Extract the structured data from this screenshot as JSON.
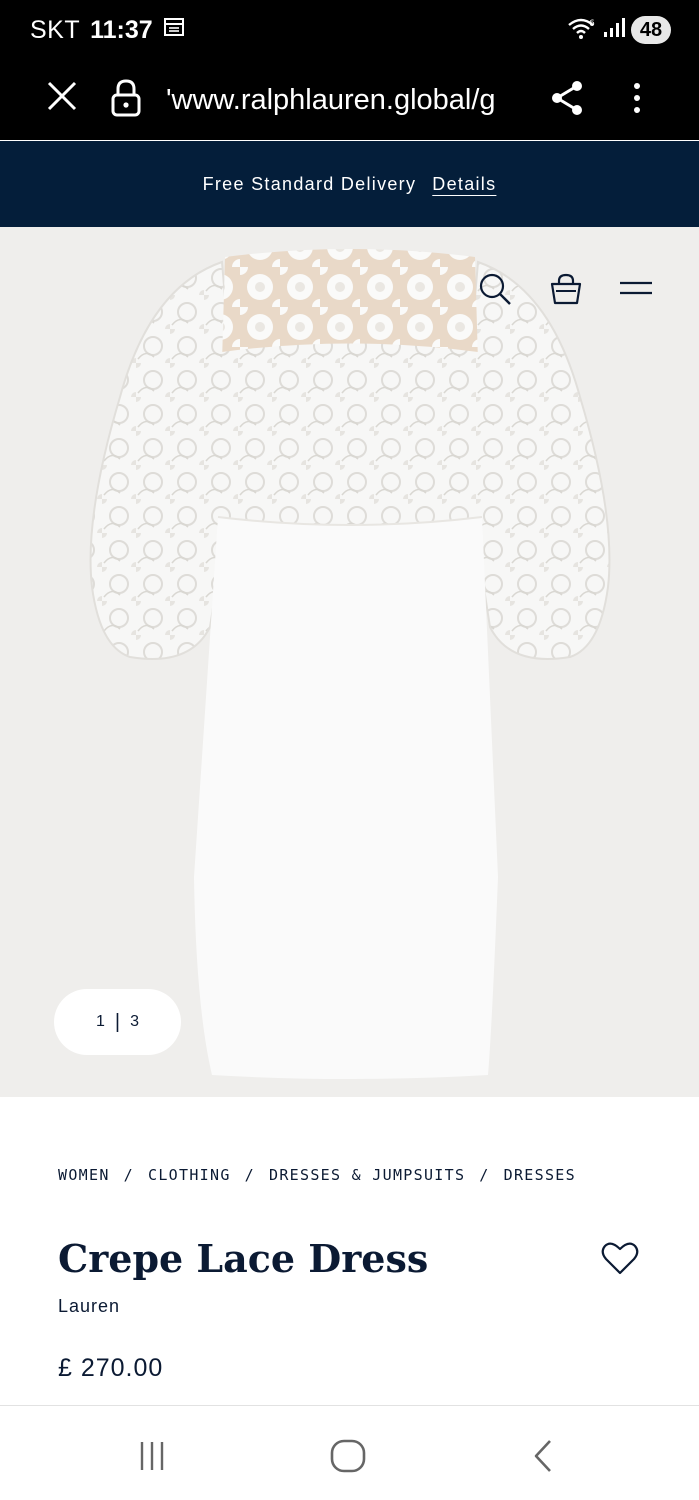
{
  "status_bar": {
    "carrier": "SKT",
    "time": "11:37",
    "battery": "48"
  },
  "browser": {
    "url": "'www.ralphlauren.global/g"
  },
  "promo": {
    "text": "Free Standard Delivery",
    "link": "Details"
  },
  "gallery": {
    "current": "1",
    "separator": "|",
    "total": "3"
  },
  "breadcrumb": {
    "items": [
      "WOMEN",
      "CLOTHING",
      "DRESSES & JUMPSUITS",
      "DRESSES"
    ],
    "separator": "/"
  },
  "product": {
    "title": "Crepe Lace Dress",
    "brand": "Lauren",
    "price": "£ 270.00"
  },
  "colors": {
    "navy": "#041e3a",
    "hero_bg": "#efeeec",
    "text": "#0b1a33"
  }
}
